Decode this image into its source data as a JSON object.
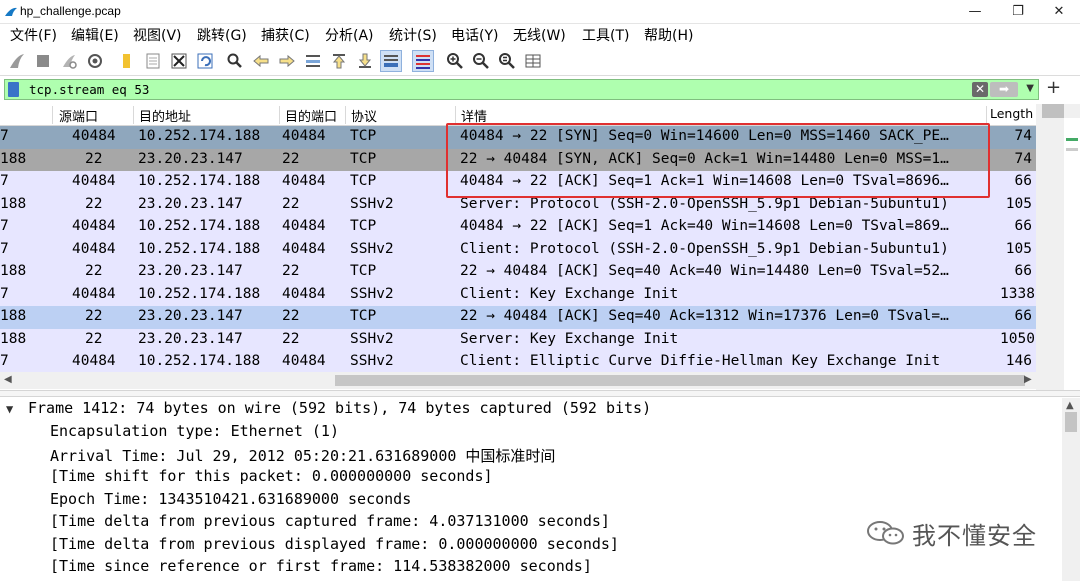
{
  "window": {
    "title": "hp_challenge.pcap",
    "controls": [
      "—",
      "❐",
      "✕"
    ]
  },
  "menu": [
    {
      "label": "文件(F)"
    },
    {
      "label": "编辑(E)"
    },
    {
      "label": "视图(V)"
    },
    {
      "label": "跳转(G)"
    },
    {
      "label": "捕获(C)"
    },
    {
      "label": "分析(A)"
    },
    {
      "label": "统计(S)"
    },
    {
      "label": "电话(Y)"
    },
    {
      "label": "无线(W)"
    },
    {
      "label": "工具(T)"
    },
    {
      "label": "帮助(H)"
    }
  ],
  "toolbar": {
    "icons": [
      "shark-fin-start-icon",
      "stop-capture-icon",
      "restart-capture-icon",
      "capture-options-icon",
      "open-file-icon",
      "file-icon",
      "close-file-icon",
      "reload-icon",
      "find-icon",
      "back-icon",
      "forward-icon",
      "goto-packet-icon",
      "first-packet-icon",
      "last-packet-icon",
      "autoscroll-icon",
      "colorize-icon",
      "zoom-in-icon",
      "zoom-out-icon",
      "zoom-normal-icon",
      "resize-columns-icon"
    ]
  },
  "filter": {
    "value": "tcp.stream eq 53",
    "apply_symbol": "➡",
    "clear_symbol": "✕",
    "add_symbol": "+"
  },
  "columns": {
    "src_port": "源端口",
    "dst_addr": "目的地址",
    "dst_port": "目的端口",
    "protocol": "协议",
    "info": "详情",
    "length": "Length"
  },
  "packets": [
    {
      "num": "7",
      "src_port": "40484",
      "dst": "10.252.174.188",
      "dst_port": "40484",
      "proto": "TCP",
      "info": "40484 → 22 [SYN] Seq=0 Win=14600 Len=0 MSS=1460 SACK_PE…",
      "len": "74",
      "style": "sel1"
    },
    {
      "num": "188",
      "src_port": "22",
      "dst": "23.20.23.147",
      "dst_port": "22",
      "proto": "TCP",
      "info": "22 → 40484 [SYN, ACK] Seq=0 Ack=1 Win=14480 Len=0 MSS=1…",
      "len": "74",
      "style": "sel2"
    },
    {
      "num": "7",
      "src_port": "40484",
      "dst": "10.252.174.188",
      "dst_port": "40484",
      "proto": "TCP",
      "info": "40484 → 22 [ACK] Seq=1 Ack=1 Win=14608 Len=0 TSval=8696…",
      "len": "66",
      "style": "tcp"
    },
    {
      "num": "188",
      "src_port": "22",
      "dst": "23.20.23.147",
      "dst_port": "22",
      "proto": "SSHv2",
      "info": "Server: Protocol (SSH-2.0-OpenSSH_5.9p1 Debian-5ubuntu1)",
      "len": "105",
      "style": "ssh"
    },
    {
      "num": "7",
      "src_port": "40484",
      "dst": "10.252.174.188",
      "dst_port": "40484",
      "proto": "TCP",
      "info": "40484 → 22 [ACK] Seq=1 Ack=40 Win=14608 Len=0 TSval=869…",
      "len": "66",
      "style": "tcp"
    },
    {
      "num": "7",
      "src_port": "40484",
      "dst": "10.252.174.188",
      "dst_port": "40484",
      "proto": "SSHv2",
      "info": "Client: Protocol (SSH-2.0-OpenSSH_5.9p1 Debian-5ubuntu1)",
      "len": "105",
      "style": "ssh"
    },
    {
      "num": "188",
      "src_port": "22",
      "dst": "23.20.23.147",
      "dst_port": "22",
      "proto": "TCP",
      "info": "22 → 40484 [ACK] Seq=40 Ack=40 Win=14480 Len=0 TSval=52…",
      "len": "66",
      "style": "tcp"
    },
    {
      "num": "7",
      "src_port": "40484",
      "dst": "10.252.174.188",
      "dst_port": "40484",
      "proto": "SSHv2",
      "info": "Client: Key Exchange Init",
      "len": "1338",
      "style": "ssh"
    },
    {
      "num": "188",
      "src_port": "22",
      "dst": "23.20.23.147",
      "dst_port": "22",
      "proto": "TCP",
      "info": "22 → 40484 [ACK] Seq=40 Ack=1312 Win=17376 Len=0 TSval=…",
      "len": "66",
      "style": "hl"
    },
    {
      "num": "188",
      "src_port": "22",
      "dst": "23.20.23.147",
      "dst_port": "22",
      "proto": "SSHv2",
      "info": "Server: Key Exchange Init",
      "len": "1050",
      "style": "ssh"
    },
    {
      "num": "7",
      "src_port": "40484",
      "dst": "10.252.174.188",
      "dst_port": "40484",
      "proto": "SSHv2",
      "info": "Client: Elliptic Curve Diffie-Hellman Key Exchange Init",
      "len": "146",
      "style": "ssh"
    }
  ],
  "details": {
    "frame_summary": "Frame 1412: 74 bytes on wire (592 bits), 74 bytes captured (592 bits)",
    "lines": [
      "Encapsulation type: Ethernet (1)",
      "Arrival Time: Jul 29, 2012 05:20:21.631689000 中国标准时间",
      "[Time shift for this packet: 0.000000000 seconds]",
      "Epoch Time: 1343510421.631689000 seconds",
      "[Time delta from previous captured frame: 4.037131000 seconds]",
      "[Time delta from previous displayed frame: 0.000000000 seconds]",
      "[Time since reference or first frame: 114.538382000 seconds]"
    ]
  },
  "watermark": {
    "text": "我不懂安全"
  },
  "colors": {
    "filter_bg": "#afffaf",
    "tcp_row": "#e7e6ff",
    "selected_row": "#8fa7bd",
    "highlight_box": "#e03030"
  }
}
